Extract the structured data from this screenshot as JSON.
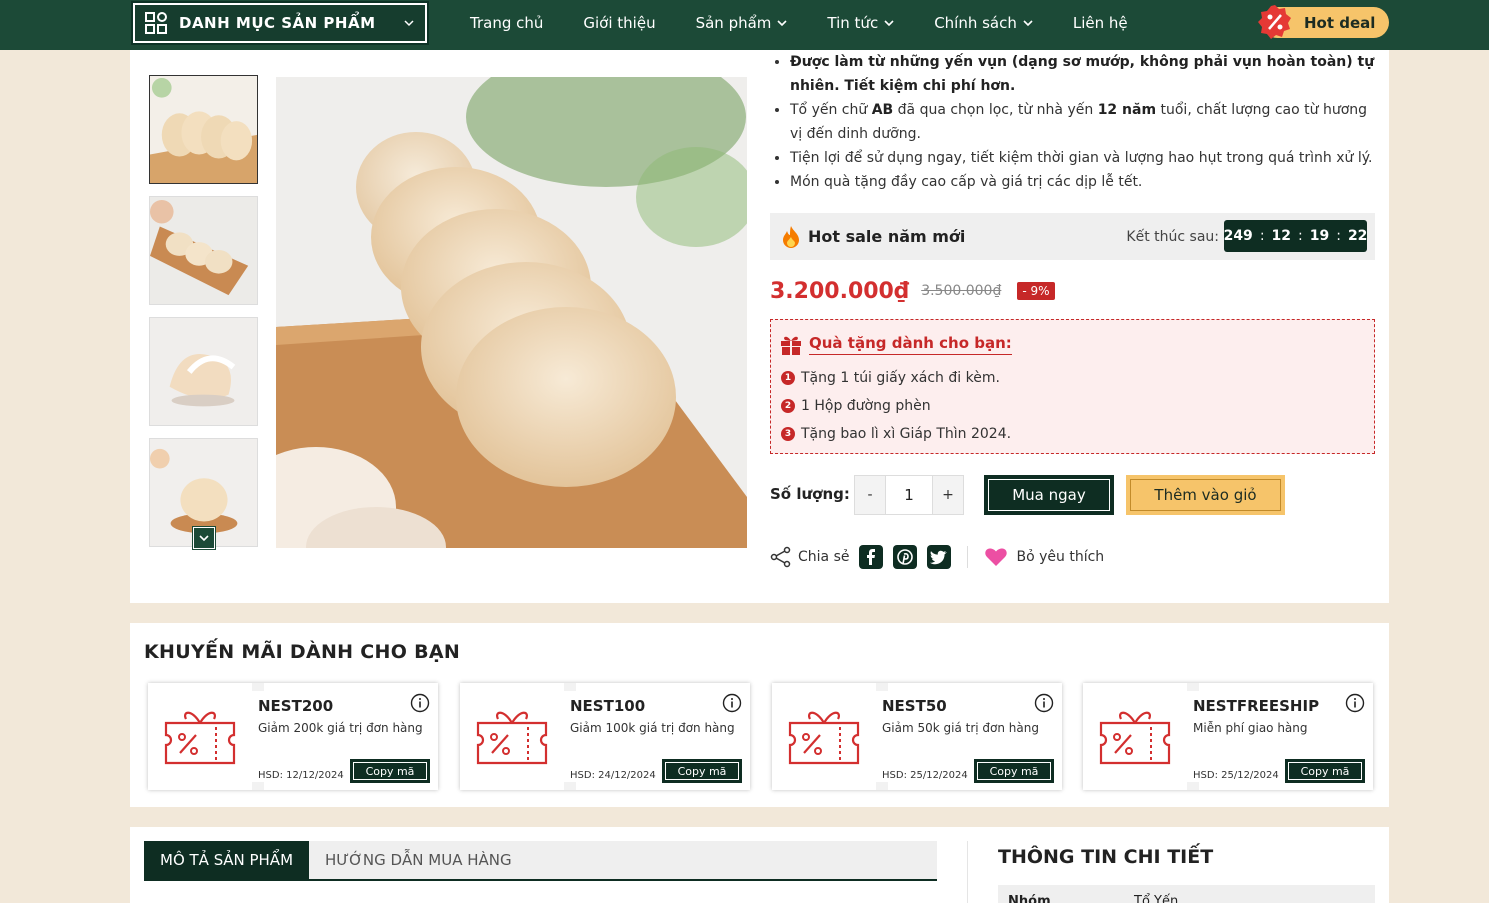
{
  "nav": {
    "category_label": "DANH MỤC SẢN PHẨM",
    "menu": [
      {
        "label": "Trang chủ",
        "dropdown": false
      },
      {
        "label": "Giới thiệu",
        "dropdown": false
      },
      {
        "label": "Sản phẩm",
        "dropdown": true
      },
      {
        "label": "Tin tức",
        "dropdown": true
      },
      {
        "label": "Chính sách",
        "dropdown": true
      },
      {
        "label": "Liên hệ",
        "dropdown": false
      }
    ],
    "hot_deal": "Hot deal"
  },
  "product": {
    "bullets": [
      "Được làm từ những yến vụn (dạng sơ mướp, không phải vụn hoàn toàn) tự nhiên. Tiết kiệm chi phí hơn.",
      "Tổ yến chữ AB đã qua chọn lọc, từ nhà yến 12 năm tuổi, chất lượng cao từ hương vị đến dinh dưỡng.",
      "Tiện lợi để sử dụng ngay, tiết kiệm thời gian và lượng hao hụt trong quá trình xử lý.",
      "Món quà tặng đầy cao cấp và giá trị các dịp lễ tết."
    ],
    "hot_sale": {
      "title": "Hot sale năm mới",
      "ends_label": "Kết thúc sau:",
      "timer": [
        "249",
        "12",
        "19",
        "22"
      ]
    },
    "price": "3.200.000₫",
    "old_price": "3.500.000₫",
    "discount": "- 9%",
    "gifts": {
      "title": "Quà tặng dành cho bạn:",
      "items": [
        {
          "num": "1",
          "text": "Tặng 1 túi giấy xách đi kèm."
        },
        {
          "num": "2",
          "text": "1 Hộp đường phèn"
        },
        {
          "num": "3",
          "text": "Tặng bao lì xì Giáp Thìn 2024."
        }
      ]
    },
    "quantity_label": "Số lượng:",
    "quantity": "1",
    "qty_minus": "-",
    "qty_plus": "+",
    "buy_now": "Mua ngay",
    "add_cart": "Thêm vào giỏ",
    "share_label": "Chia sẻ",
    "favorite_label": "Bỏ yêu thích"
  },
  "promotions": {
    "title": "KHUYẾN MÃI DÀNH CHO BẠN",
    "copy_label": "Copy mã",
    "coupons": [
      {
        "code": "NEST200",
        "desc": "Giảm 200k giá trị đơn hàng",
        "expiry": "HSD: 12/12/2024"
      },
      {
        "code": "NEST100",
        "desc": "Giảm 100k giá trị đơn hàng",
        "expiry": "HSD: 24/12/2024"
      },
      {
        "code": "NEST50",
        "desc": "Giảm 50k giá trị đơn hàng",
        "expiry": "HSD: 25/12/2024"
      },
      {
        "code": "NESTFREESHIP",
        "desc": "Miễn phí giao hàng",
        "expiry": "HSD: 25/12/2024"
      }
    ]
  },
  "details": {
    "tabs": [
      "MÔ TẢ SẢN PHẨM",
      "HƯỚNG DẪN MUA HÀNG"
    ],
    "info_title": "THÔNG TIN CHI TIẾT",
    "rows": [
      {
        "key": "Nhóm",
        "value": "Tổ Yến"
      }
    ]
  },
  "colors": {
    "brand": "#1c4a37",
    "dark": "#0e2d22",
    "accent": "#f6c46a",
    "price": "#d32f2f"
  }
}
